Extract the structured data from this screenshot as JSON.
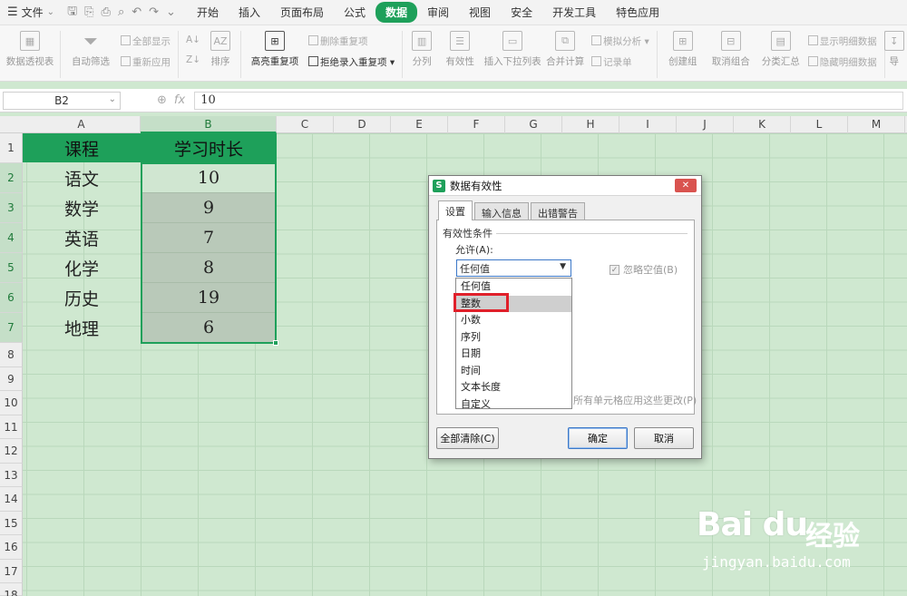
{
  "menubar": {
    "file_label": "文件",
    "tabs": [
      "开始",
      "插入",
      "页面布局",
      "公式",
      "数据",
      "审阅",
      "视图",
      "安全",
      "开发工具",
      "特色应用"
    ],
    "active_tab": "数据"
  },
  "ribbon": {
    "pivot": "数据透视表",
    "autofilter": "自动筛选",
    "show_all": "全部显示",
    "reapply": "重新应用",
    "sort": "排序",
    "highlight_dup": "高亮重复项",
    "delete_dup": "删除重复项",
    "reject_dup": "拒绝录入重复项",
    "split": "分列",
    "validity": "有效性",
    "insert_dropdown": "插入下拉列表",
    "consolidate": "合并计算",
    "simulation": "模拟分析",
    "record": "记录单",
    "group": "创建组",
    "ungroup": "取消组合",
    "subtotal": "分类汇总",
    "show_detail": "显示明细数据",
    "hide_detail": "隐藏明细数据",
    "more": "导"
  },
  "formula_bar": {
    "name_box": "B2",
    "fx": "fx",
    "value": "10"
  },
  "sheet": {
    "columns": [
      "A",
      "B",
      "C",
      "D",
      "E",
      "F",
      "G",
      "H",
      "I",
      "J",
      "K",
      "L",
      "M"
    ],
    "rows": [
      "1",
      "2",
      "3",
      "4",
      "5",
      "6",
      "7",
      "8",
      "9",
      "10",
      "11",
      "12",
      "13",
      "14",
      "15",
      "16",
      "17",
      "18"
    ],
    "header": {
      "a": "课程",
      "b": "学习时长"
    },
    "data": [
      {
        "course": "语文",
        "hours": "10"
      },
      {
        "course": "数学",
        "hours": "9"
      },
      {
        "course": "英语",
        "hours": "7"
      },
      {
        "course": "化学",
        "hours": "8"
      },
      {
        "course": "历史",
        "hours": "19"
      },
      {
        "course": "地理",
        "hours": "6"
      }
    ]
  },
  "dialog": {
    "title": "数据有效性",
    "close": "✕",
    "tabs": [
      "设置",
      "输入信息",
      "出错警告"
    ],
    "criteria_legend": "有效性条件",
    "allow_label": "允许(A):",
    "allow_value": "任何值",
    "ignore_blank": "忽略空值(B)",
    "options": [
      "任何值",
      "整数",
      "小数",
      "序列",
      "日期",
      "时间",
      "文本长度",
      "自定义"
    ],
    "highlighted_option": "整数",
    "apply_text": "所有单元格应用这些更改(P)",
    "clear_all": "全部清除(C)",
    "ok": "确定",
    "cancel": "取消"
  },
  "watermark": {
    "brand": "Bai du",
    "brand_cn": "经验",
    "url": "jingyan.baidu.com"
  }
}
